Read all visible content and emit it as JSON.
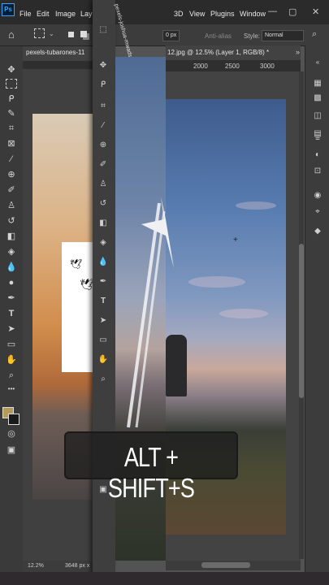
{
  "menubar": {
    "logo": "Ps",
    "items": [
      "File",
      "Edit",
      "Image",
      "Lay"
    ],
    "items_right": [
      "3D",
      "View",
      "Plugins",
      "Window"
    ],
    "window_controls": [
      "—",
      "▢",
      "✕"
    ]
  },
  "options": {
    "size_value": "0 px",
    "anti_alias_label": "Anti-alias",
    "style_label": "Style:",
    "style_value": "Normal"
  },
  "left_document": {
    "tab_title": "pexels-tubarones-11",
    "zoom": "12.2%",
    "size_info": "3648 px x"
  },
  "front_panel": {
    "vertical_tab": "pexels-joshua-mwadsarah-..."
  },
  "right_document": {
    "tab_title": "12.jpg @ 12.5% (Layer 1, RGB/8) *",
    "ruler_labels": [
      "2000",
      "2500",
      "3000"
    ]
  },
  "caption": {
    "text": "ALT + SHIFT+S"
  },
  "icons": {
    "colors": {
      "foreground": "#b69a5a",
      "background": "#1a1a1a",
      "ps_accent": "#31a8ff"
    }
  }
}
